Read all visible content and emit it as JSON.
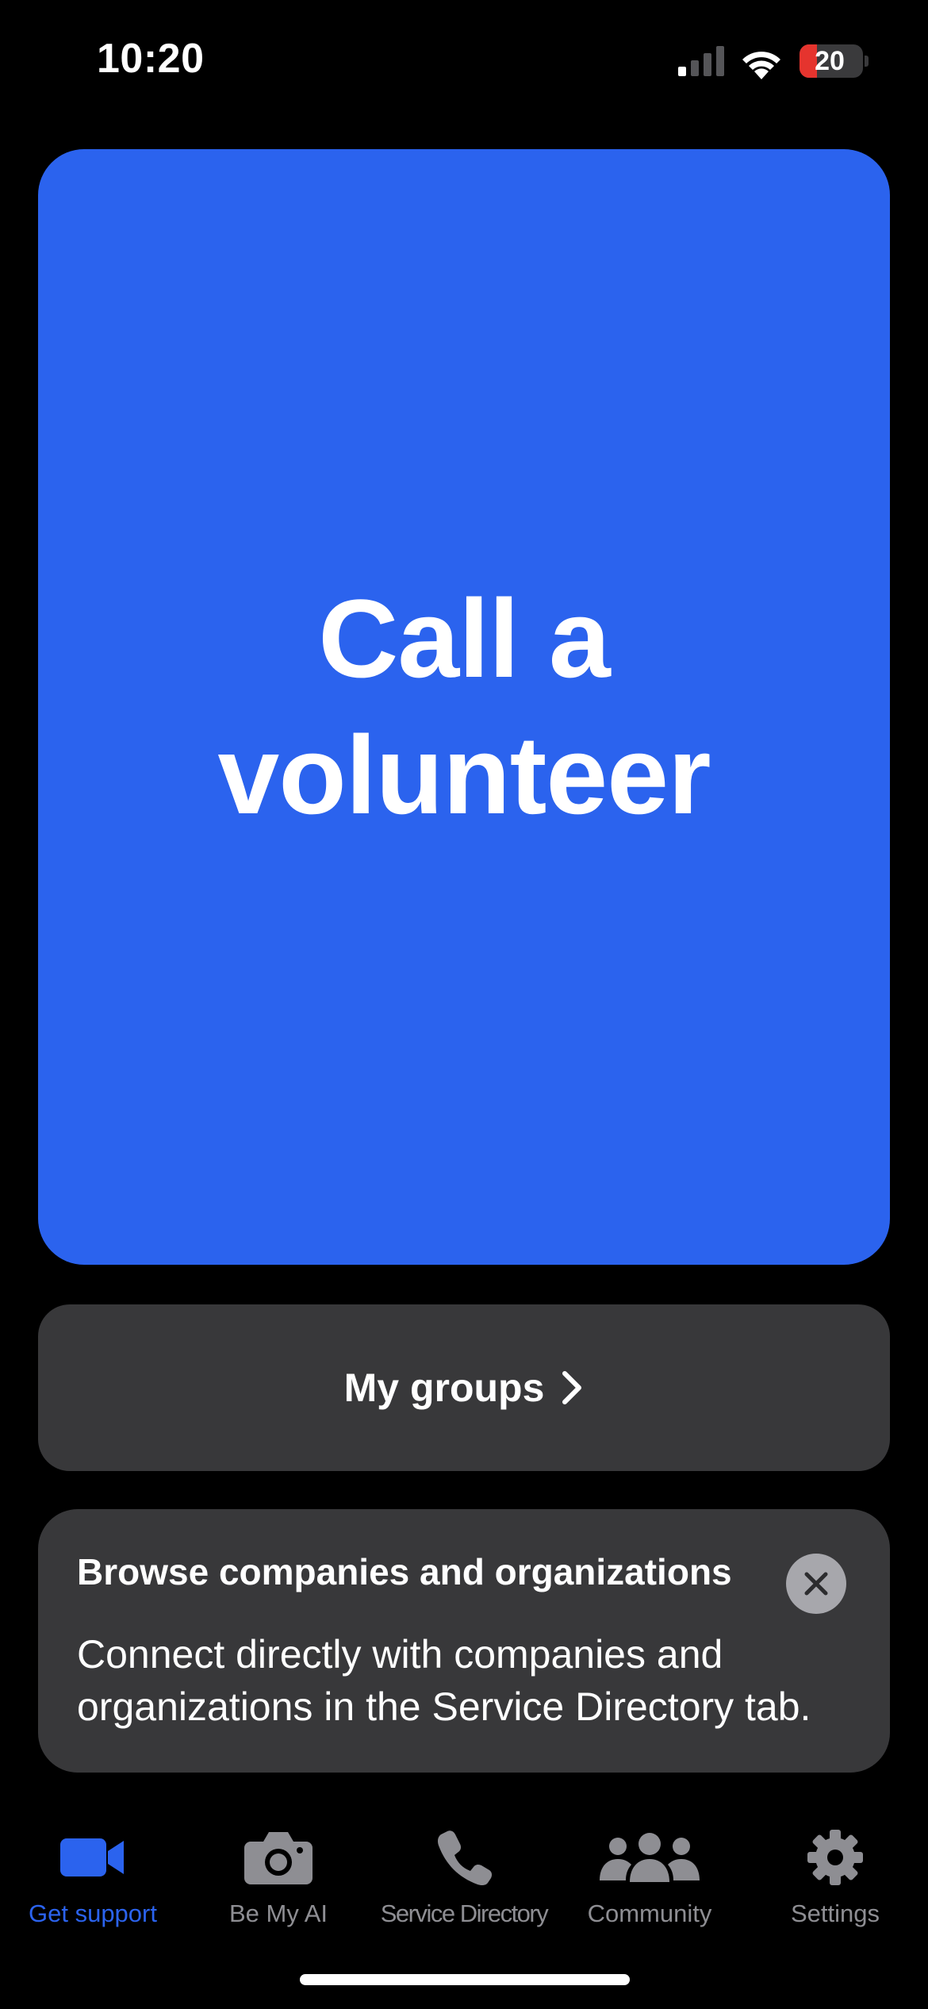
{
  "status_bar": {
    "time": "10:20",
    "battery_level": "20",
    "battery_color": "#e5342e",
    "signal_bars_active": 1,
    "signal_bars_total": 4
  },
  "main": {
    "call_button_label": "Call a volunteer",
    "groups_button_label": "My groups",
    "browse_card": {
      "title": "Browse companies and organizations",
      "body": "Connect directly with companies and organizations in the Service Directory tab.",
      "close_icon": "close-icon"
    }
  },
  "tab_bar": {
    "active_color": "#2b63ee",
    "inactive_color": "#8e8e93",
    "tabs": [
      {
        "label": "Get support",
        "icon": "video-camera-icon",
        "active": true
      },
      {
        "label": "Be My AI",
        "icon": "camera-icon",
        "active": false
      },
      {
        "label": "Service Directory",
        "icon": "phone-icon",
        "active": false
      },
      {
        "label": "Community",
        "icon": "people-icon",
        "active": false
      },
      {
        "label": "Settings",
        "icon": "gear-icon",
        "active": false
      }
    ]
  },
  "colors": {
    "background": "#000000",
    "primary_button": "#2b63ee",
    "card": "#38383a"
  }
}
